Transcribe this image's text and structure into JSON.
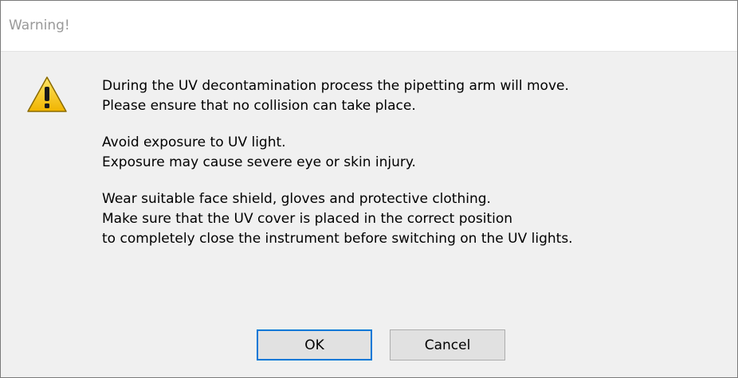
{
  "window": {
    "title": "Warning!"
  },
  "icon": "warning-triangle-icon",
  "message": {
    "paragraphs": [
      {
        "lines": [
          "During the UV decontamination process the pipetting arm will move.",
          "Please ensure that no collision can take place."
        ]
      },
      {
        "lines": [
          "Avoid exposure to UV light.",
          "Exposure may cause severe eye or skin injury."
        ]
      },
      {
        "lines": [
          "Wear suitable face shield, gloves and protective clothing.",
          "Make sure that the UV cover is placed in the correct position",
          "to completely close the instrument before switching on the UV lights."
        ]
      }
    ]
  },
  "buttons": {
    "ok_label": "OK",
    "cancel_label": "Cancel"
  },
  "colors": {
    "warning_fill": "#f5c400",
    "warning_border": "#8a6a00",
    "focus_border": "#0078d7"
  }
}
